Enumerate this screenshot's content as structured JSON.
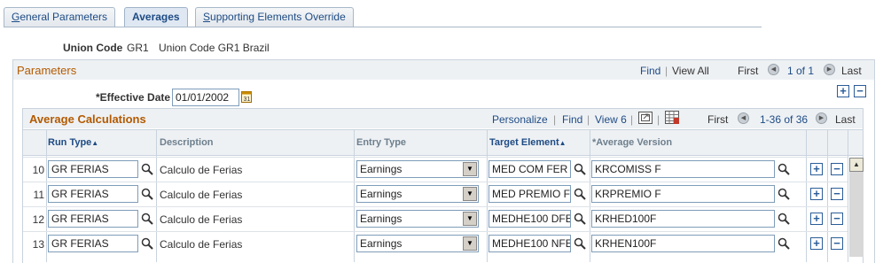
{
  "tabs": [
    {
      "label": "General Parameters",
      "underline": "G",
      "rest": "eneral Parameters"
    },
    {
      "label": "Averages"
    },
    {
      "label": "Supporting Elements Override",
      "underline": "S",
      "rest": "upporting Elements Override"
    }
  ],
  "union": {
    "label": "Union Code",
    "code": "GR1",
    "name": "Union Code GR1 Brazil"
  },
  "parameters": {
    "title": "Parameters",
    "find": "Find",
    "view_all": "View All",
    "first": "First",
    "range": "1 of 1",
    "last": "Last",
    "effective_date_label": "*Effective Date",
    "effective_date": "01/01/2002"
  },
  "grid": {
    "title": "Average Calculations",
    "personalize": "Personalize",
    "find": "Find",
    "view": "View 6",
    "first": "First",
    "range": "1-36 of 36",
    "last": "Last",
    "columns": {
      "run_type": "Run Type",
      "description": "Description",
      "entry_type": "Entry Type",
      "target_element": "Target Element",
      "average_version": "*Average Version"
    },
    "rows": [
      {
        "num": "10",
        "run_type": "GR FERIAS",
        "description": "Calculo de Ferias",
        "entry_type": "Earnings",
        "target": "MED COM FER",
        "version": "KRCOMISS F"
      },
      {
        "num": "11",
        "run_type": "GR FERIAS",
        "description": "Calculo de Ferias",
        "entry_type": "Earnings",
        "target": "MED PREMIO F",
        "version": "KRPREMIO F"
      },
      {
        "num": "12",
        "run_type": "GR FERIAS",
        "description": "Calculo de Ferias",
        "entry_type": "Earnings",
        "target": "MEDHE100 DFE",
        "version": "KRHED100F"
      },
      {
        "num": "13",
        "run_type": "GR FERIAS",
        "description": "Calculo de Ferias",
        "entry_type": "Earnings",
        "target": "MEDHE100 NFE",
        "version": "KRHEN100F"
      }
    ]
  },
  "icons": {
    "lookup": "magnifier-icon",
    "calendar": "calendar-icon",
    "add": "plus-icon",
    "delete": "minus-icon",
    "download": "spreadsheet-icon",
    "zoom": "new-window-icon"
  }
}
